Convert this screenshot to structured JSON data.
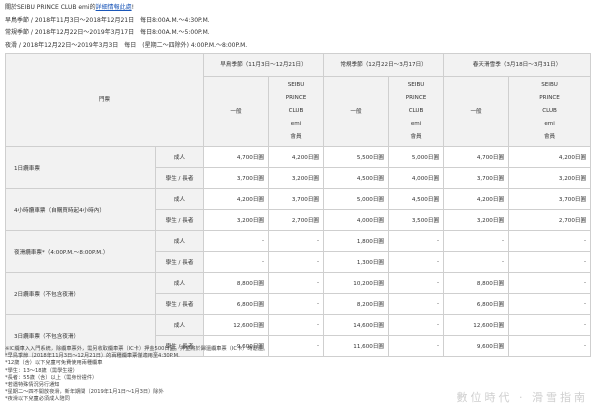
{
  "intro": {
    "line1_prefix": "關於SEIBU PRINCE CLUB emi的",
    "line1_link": "詳細情報此處",
    "line1_suffix": "!",
    "line2": "早鳥季節 / 2018年11月3日～2018年12月21日　每日8:00A.M.～4:30P.M.",
    "line3": "常規季節 / 2018年12月22日～2019年3月17日　每日8:00A.M.～5:00P.M.",
    "line4": "夜滑 / 2018年12月22日～2019年3月3日　每日　(星期二～四除外) 4:00P.M.～8:00P.M."
  },
  "table": {
    "corner": "門票",
    "seasons": [
      "早鳥季節（11月3日～12月21日）",
      "常規季節（12月22日～3月17日）",
      "春天滑雪季（3月18日～3月31日）"
    ],
    "general": "一般",
    "member": [
      "SEIBU",
      "PRINCE",
      "CLUB",
      "emi",
      "會員"
    ],
    "rows": [
      {
        "ticket": "1日纜車票",
        "audience": "成人",
        "values": [
          "4,700日圓",
          "4,200日圓",
          "5,500日圓",
          "5,000日圓",
          "4,700日圓",
          "4,200日圓"
        ]
      },
      {
        "ticket": "",
        "audience": "學生 / 長者",
        "values": [
          "3,700日圓",
          "3,200日圓",
          "4,500日圓",
          "4,000日圓",
          "3,700日圓",
          "3,200日圓"
        ]
      },
      {
        "ticket": "4小時纜車票（自購買時起4小時內）",
        "audience": "成人",
        "values": [
          "4,200日圓",
          "3,700日圓",
          "5,000日圓",
          "4,500日圓",
          "4,200日圓",
          "3,700日圓"
        ]
      },
      {
        "ticket": "",
        "audience": "學生 / 長者",
        "values": [
          "3,200日圓",
          "2,700日圓",
          "4,000日圓",
          "3,500日圓",
          "3,200日圓",
          "2,700日圓"
        ]
      },
      {
        "ticket": "夜滑纜車票*（4:00P.M.～8:00P.M.）",
        "audience": "成人",
        "values": [
          "-",
          "-",
          "1,800日圓",
          "-",
          "-",
          "-"
        ]
      },
      {
        "ticket": "",
        "audience": "學生 / 長者",
        "values": [
          "-",
          "-",
          "1,300日圓",
          "-",
          "-",
          "-"
        ]
      },
      {
        "ticket": "2日纜車票（不包含夜滑）",
        "audience": "成人",
        "values": [
          "8,800日圓",
          "-",
          "10,200日圓",
          "-",
          "8,800日圓",
          "-"
        ]
      },
      {
        "ticket": "",
        "audience": "學生 / 長者",
        "values": [
          "6,800日圓",
          "-",
          "8,200日圓",
          "-",
          "6,800日圓",
          "-"
        ]
      },
      {
        "ticket": "3日纜車票（不包含夜滑）",
        "audience": "成人",
        "values": [
          "12,600日圓",
          "-",
          "14,600日圓",
          "-",
          "12,600日圓",
          "-"
        ]
      },
      {
        "ticket": "",
        "audience": "學生 / 長者",
        "values": [
          "9,600日圓",
          "-",
          "11,600日圓",
          "-",
          "9,600日圓",
          "-"
        ]
      }
    ]
  },
  "notes": [
    "※IC纜車入入門系統，除纜車票外，需另收取纜車票（IC卡）押金500日圓。押金將於歸還纜車票（IC卡）時退還。",
    "*早鳥季節（2018年11月3日～12月21日）的兩種纜車票僅適用至4:30P.M.",
    "*12歲（含）以下兒童可免費使用兩種纜車",
    "*學生：13～18歲（需學生證）",
    "*長者：55歲（含）以上（需身份證件）",
    "*若遇特殊情況另行通知",
    "*星期二～四不開放夜滑，新年期間（2019年1月1日～1月3日）除外",
    "*夜滑以下兒童必須成人陪同"
  ],
  "watermark": "數位時代 · 滑雪指南"
}
